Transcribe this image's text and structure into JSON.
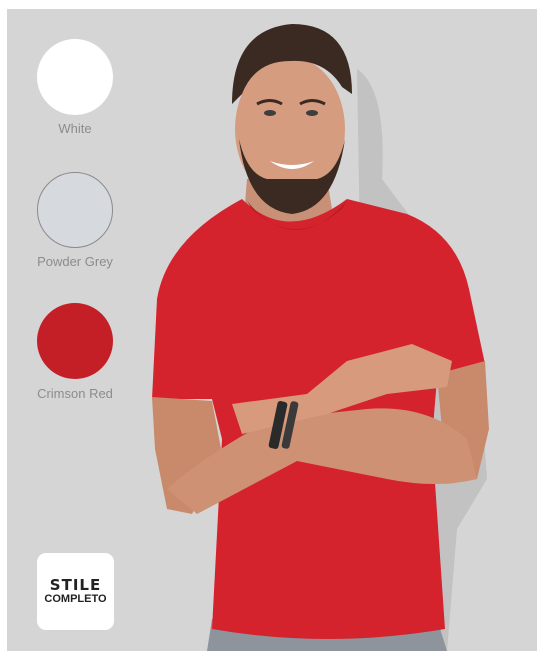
{
  "swatches": [
    {
      "label": "White",
      "color": "#ffffff"
    },
    {
      "label": "Powder Grey",
      "color": "#d6d9de"
    },
    {
      "label": "Crimson Red",
      "color": "#c41f26"
    }
  ],
  "badge": {
    "line1": "STILE",
    "line2": "COMPLETO"
  },
  "photo": {
    "subject": "man-in-red-tshirt-arms-crossed",
    "shirt_color": "#d5232e"
  }
}
